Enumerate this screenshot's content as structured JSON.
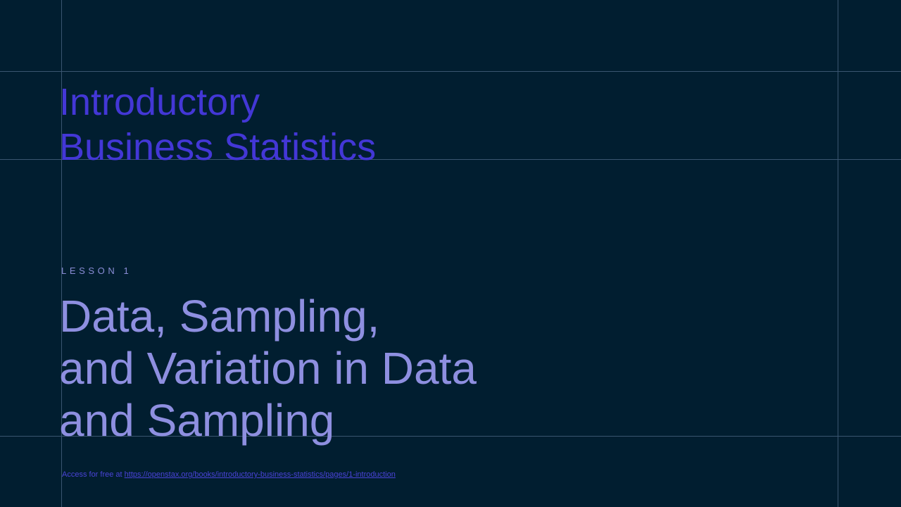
{
  "book": {
    "title_line1": "Introductory",
    "title_line2": "Business Statistics"
  },
  "lesson": {
    "label": "LESSON 1",
    "title_line1": "Data, Sampling,",
    "title_line2": "and Variation in Data",
    "title_line3": "and Sampling"
  },
  "footer": {
    "access_text": "Access for free at",
    "link_text": "https://openstax.org/books/introductory-business-statistics/pages/1-introduction"
  },
  "colors": {
    "background": "#011e30",
    "book_title": "#4337d6",
    "lesson_title": "#8e8fe0",
    "grid_lines": "#3a5570",
    "link": "#4a43d8"
  }
}
